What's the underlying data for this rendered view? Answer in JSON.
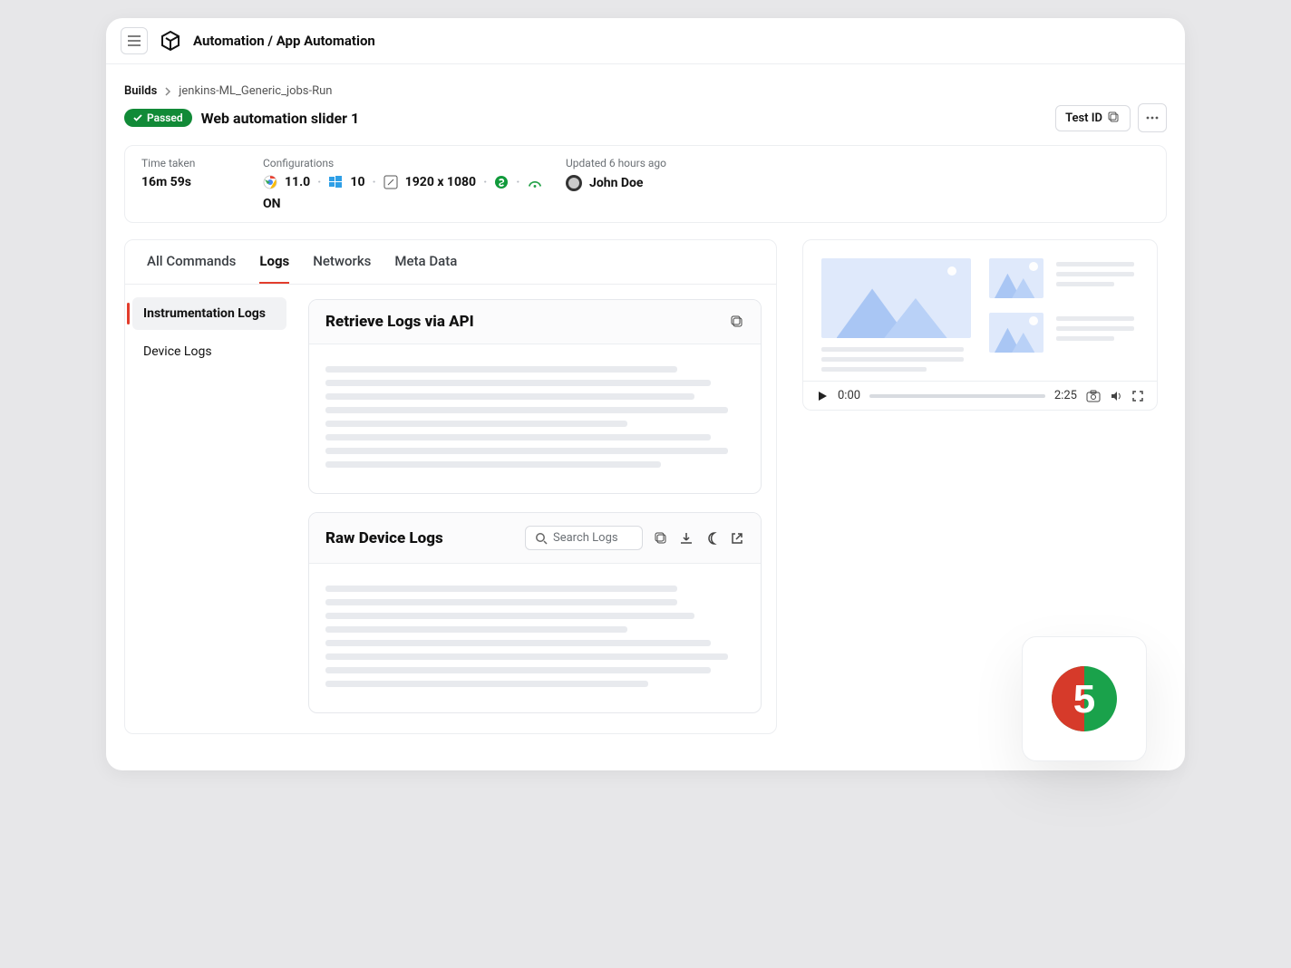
{
  "topbar": {
    "title": "Automation / App Automation"
  },
  "breadcrumb": {
    "root": "Builds",
    "current": "jenkins-ML_Generic_jobs-Run"
  },
  "status": {
    "label": "Passed"
  },
  "test": {
    "title": "Web automation slider 1"
  },
  "actions": {
    "testId": "Test ID"
  },
  "meta": {
    "timeTakenLabel": "Time taken",
    "timeTaken": "16m 59s",
    "configLabel": "Configurations",
    "browserVersion": "11.0",
    "windowsVersion": "10",
    "resolution": "1920 x 1080",
    "networkStatus": "ON",
    "updatedLabel": "Updated 6 hours ago",
    "user": "John Doe"
  },
  "tabs": {
    "all": "All Commands",
    "logs": "Logs",
    "networks": "Networks",
    "meta": "Meta Data"
  },
  "leftnav": {
    "instrumentation": "Instrumentation Logs",
    "device": "Device Logs"
  },
  "cards": {
    "retrieve": "Retrieve Logs via API",
    "raw": "Raw Device Logs",
    "searchPlaceholder": "Search Logs"
  },
  "video": {
    "current": "0:00",
    "duration": "2:25"
  }
}
